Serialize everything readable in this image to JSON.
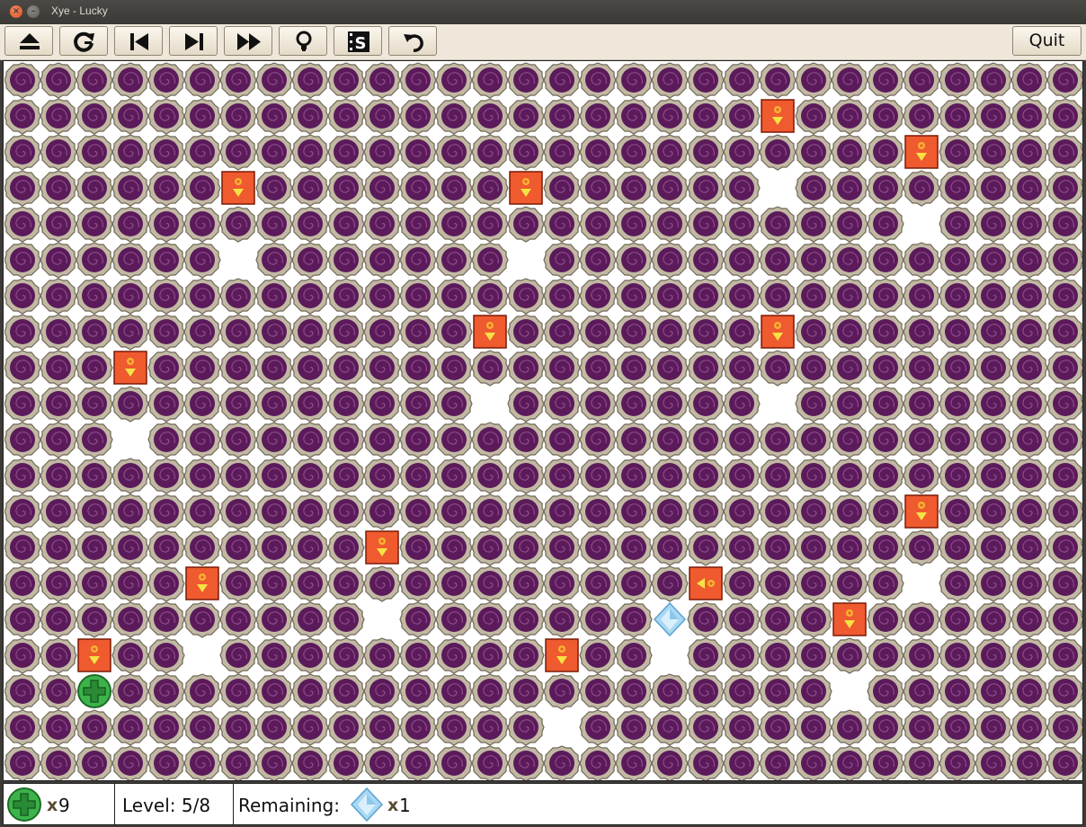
{
  "window": {
    "title": "Xye - Lucky"
  },
  "toolbar": {
    "buttons": [
      {
        "icon": "eject-icon"
      },
      {
        "icon": "restart-icon"
      },
      {
        "icon": "previous-level-icon"
      },
      {
        "icon": "next-level-icon"
      },
      {
        "icon": "fast-forward-icon"
      },
      {
        "icon": "hint-bulb-icon"
      },
      {
        "icon": "solution-film-icon"
      },
      {
        "icon": "undo-icon"
      }
    ],
    "quit_label": "Quit"
  },
  "colors": {
    "block": "#ef5a2f",
    "player": "#3bb34a",
    "gem": "#a9d8f2",
    "swirl": "#5b1b5a"
  },
  "board": {
    "cols": 30,
    "rows": 20,
    "empty_cells": [
      [
        21,
        3
      ],
      [
        25,
        4
      ],
      [
        6,
        5
      ],
      [
        14,
        5
      ],
      [
        13,
        9
      ],
      [
        21,
        9
      ],
      [
        3,
        10
      ],
      [
        25,
        14
      ],
      [
        10,
        15
      ],
      [
        5,
        16
      ],
      [
        18,
        16
      ],
      [
        15,
        18
      ],
      [
        23,
        17
      ]
    ],
    "blocks": [
      {
        "col": 21,
        "row": 1,
        "dir": "down"
      },
      {
        "col": 25,
        "row": 2,
        "dir": "down"
      },
      {
        "col": 6,
        "row": 3,
        "dir": "down"
      },
      {
        "col": 14,
        "row": 3,
        "dir": "down"
      },
      {
        "col": 13,
        "row": 7,
        "dir": "down"
      },
      {
        "col": 21,
        "row": 7,
        "dir": "down"
      },
      {
        "col": 3,
        "row": 8,
        "dir": "down"
      },
      {
        "col": 25,
        "row": 12,
        "dir": "down"
      },
      {
        "col": 10,
        "row": 13,
        "dir": "down"
      },
      {
        "col": 5,
        "row": 14,
        "dir": "down"
      },
      {
        "col": 19,
        "row": 14,
        "dir": "left"
      },
      {
        "col": 23,
        "row": 15,
        "dir": "down"
      },
      {
        "col": 2,
        "row": 16,
        "dir": "down"
      },
      {
        "col": 15,
        "row": 16,
        "dir": "down"
      }
    ],
    "gems": [
      {
        "col": 18,
        "row": 15
      }
    ],
    "player": {
      "col": 2,
      "row": 17
    }
  },
  "status": {
    "lives": "9",
    "level": "Level: 5/8",
    "remaining_label": "Remaining:",
    "remaining_count": "1"
  }
}
